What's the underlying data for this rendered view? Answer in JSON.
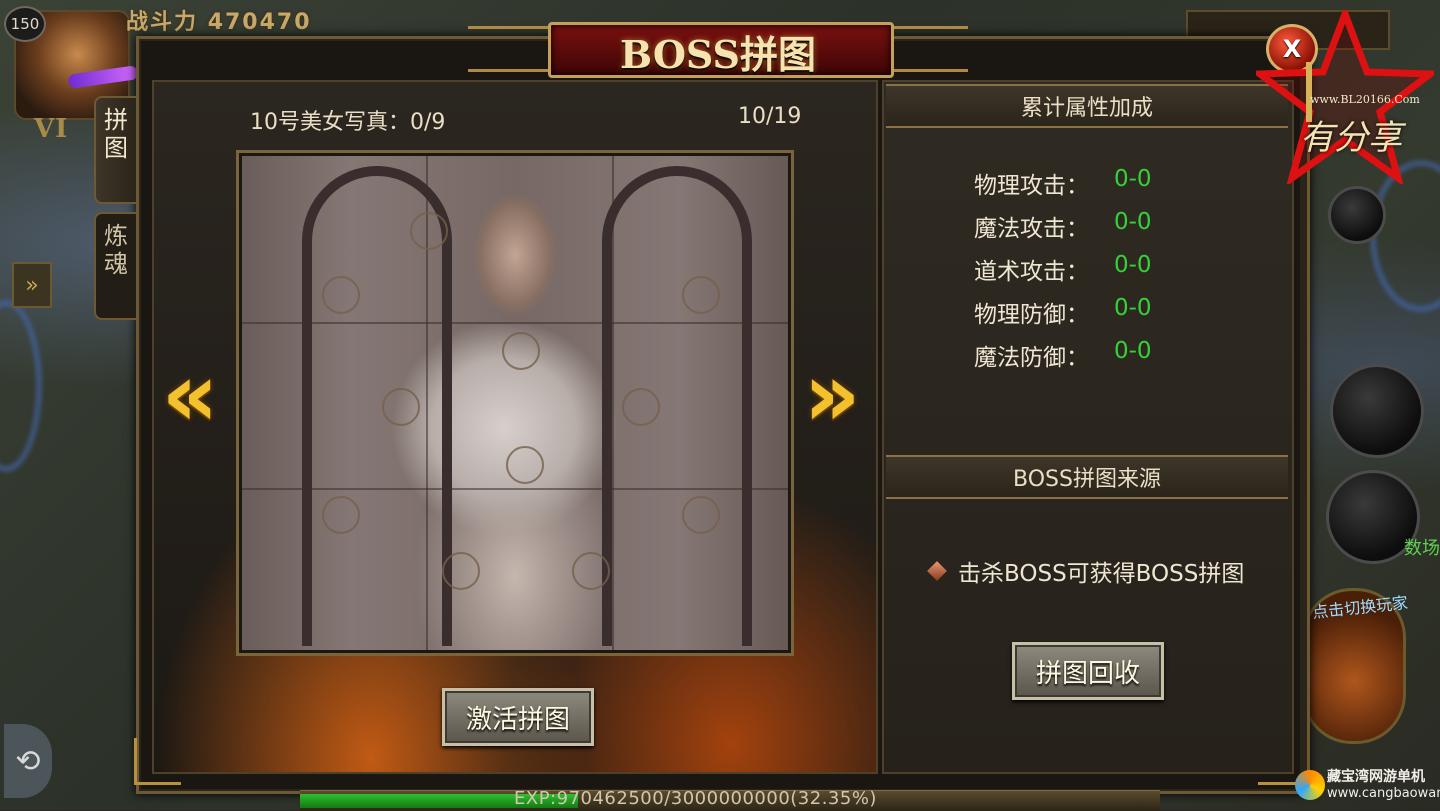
{
  "hud": {
    "level": "150",
    "power_label": "战斗力",
    "power_value": "470470",
    "vip": "VI",
    "left_toggle": "»",
    "refresh_glyph": "⟲",
    "side_text": "数场",
    "switch_player_label": "点击切换玩家"
  },
  "panel": {
    "title": "BOSS拼图",
    "close_label": "X",
    "tabs": [
      {
        "label": "拼图",
        "active": true
      },
      {
        "label": "炼魂",
        "active": false
      }
    ]
  },
  "puzzle": {
    "title": "10号美女写真：0/9",
    "page": "10/19",
    "prev_glyph": "«",
    "next_glyph": "»",
    "activate_label": "激活拼图"
  },
  "attributes": {
    "header": "累计属性加成",
    "items": [
      {
        "label": "物理攻击：",
        "value": "0-0"
      },
      {
        "label": "魔法攻击：",
        "value": "0-0"
      },
      {
        "label": "道术攻击：",
        "value": "0-0"
      },
      {
        "label": "物理防御：",
        "value": "0-0"
      },
      {
        "label": "魔法防御：",
        "value": "0-0"
      }
    ]
  },
  "source": {
    "header": "BOSS拼图来源",
    "text": "击杀BOSS可获得BOSS拼图",
    "recycle_label": "拼图回收"
  },
  "exp": {
    "text": "EXP:970462500/3000000000(32.35%)",
    "fraction": 0.3235
  },
  "watermarks": {
    "url": "www.BL20166.Com",
    "logo": "有分享",
    "site_name": "藏宝湾网游单机",
    "site_url": "www.cangbaowan.net"
  },
  "colors": {
    "accent_gold": "#c4a05a",
    "value_green": "#35d13a",
    "title_red": "#7a1010"
  }
}
